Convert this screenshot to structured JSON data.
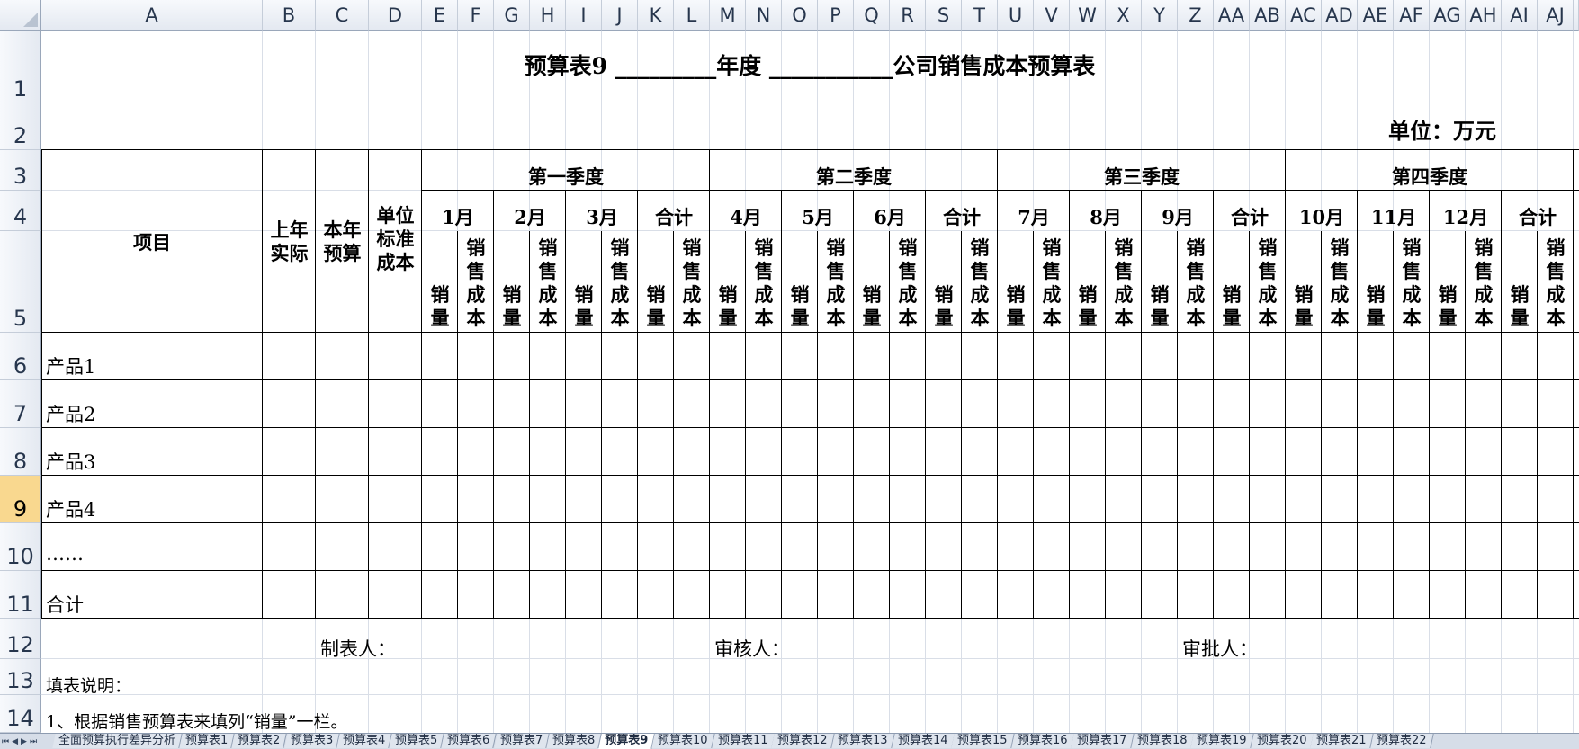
{
  "columns": [
    "A",
    "B",
    "C",
    "D",
    "E",
    "F",
    "G",
    "H",
    "I",
    "J",
    "K",
    "L",
    "M",
    "N",
    "O",
    "P",
    "Q",
    "R",
    "S",
    "T",
    "U",
    "V",
    "W",
    "X",
    "Y",
    "Z",
    "AA",
    "AB",
    "AC",
    "AD",
    "AE",
    "AF",
    "AG",
    "AH",
    "AI",
    "AJ"
  ],
  "rows": [
    "1",
    "2",
    "3",
    "4",
    "5",
    "6",
    "7",
    "8",
    "9",
    "10",
    "11",
    "12",
    "13",
    "14"
  ],
  "selected_row": "9",
  "title": "预算表9 _________年度 ___________公司销售成本预算表",
  "unit": "单位：万元",
  "header": {
    "item": "项目",
    "last_year": "上年\n实际",
    "this_year": "本年\n预算",
    "unit_cost": "单位\n标准\n成本"
  },
  "quarters": [
    "第一季度",
    "第二季度",
    "第三季度",
    "第四季度"
  ],
  "months": [
    "1月",
    "2月",
    "3月",
    "合计",
    "4月",
    "5月",
    "6月",
    "合计",
    "7月",
    "8月",
    "9月",
    "合计",
    "10月",
    "11月",
    "12月",
    "合计"
  ],
  "sub_qty": "销量",
  "sub_cost": "销售成本",
  "products": [
    "产品1",
    "产品2",
    "产品3",
    "产品4",
    "……",
    "合计"
  ],
  "footer": {
    "maker": "制表人：",
    "reviewer": "审核人：",
    "approver": "审批人：",
    "note_title": "填表说明：",
    "note_1": "1、根据销售预算表来填列“销量”一栏。"
  },
  "sheet_tabs": [
    "全面预算执行差异分析",
    "预算表1",
    "预算表2",
    "预算表3",
    "预算表4",
    "预算表5",
    "预算表6",
    "预算表7",
    "预算表8",
    "预算表9",
    "预算表10",
    "预算表11",
    "预算表12",
    "预算表13",
    "预算表14",
    "预算表15",
    "预算表16",
    "预算表17",
    "预算表18",
    "预算表19",
    "预算表20",
    "预算表21",
    "预算表22"
  ],
  "active_tab": "预算表9"
}
